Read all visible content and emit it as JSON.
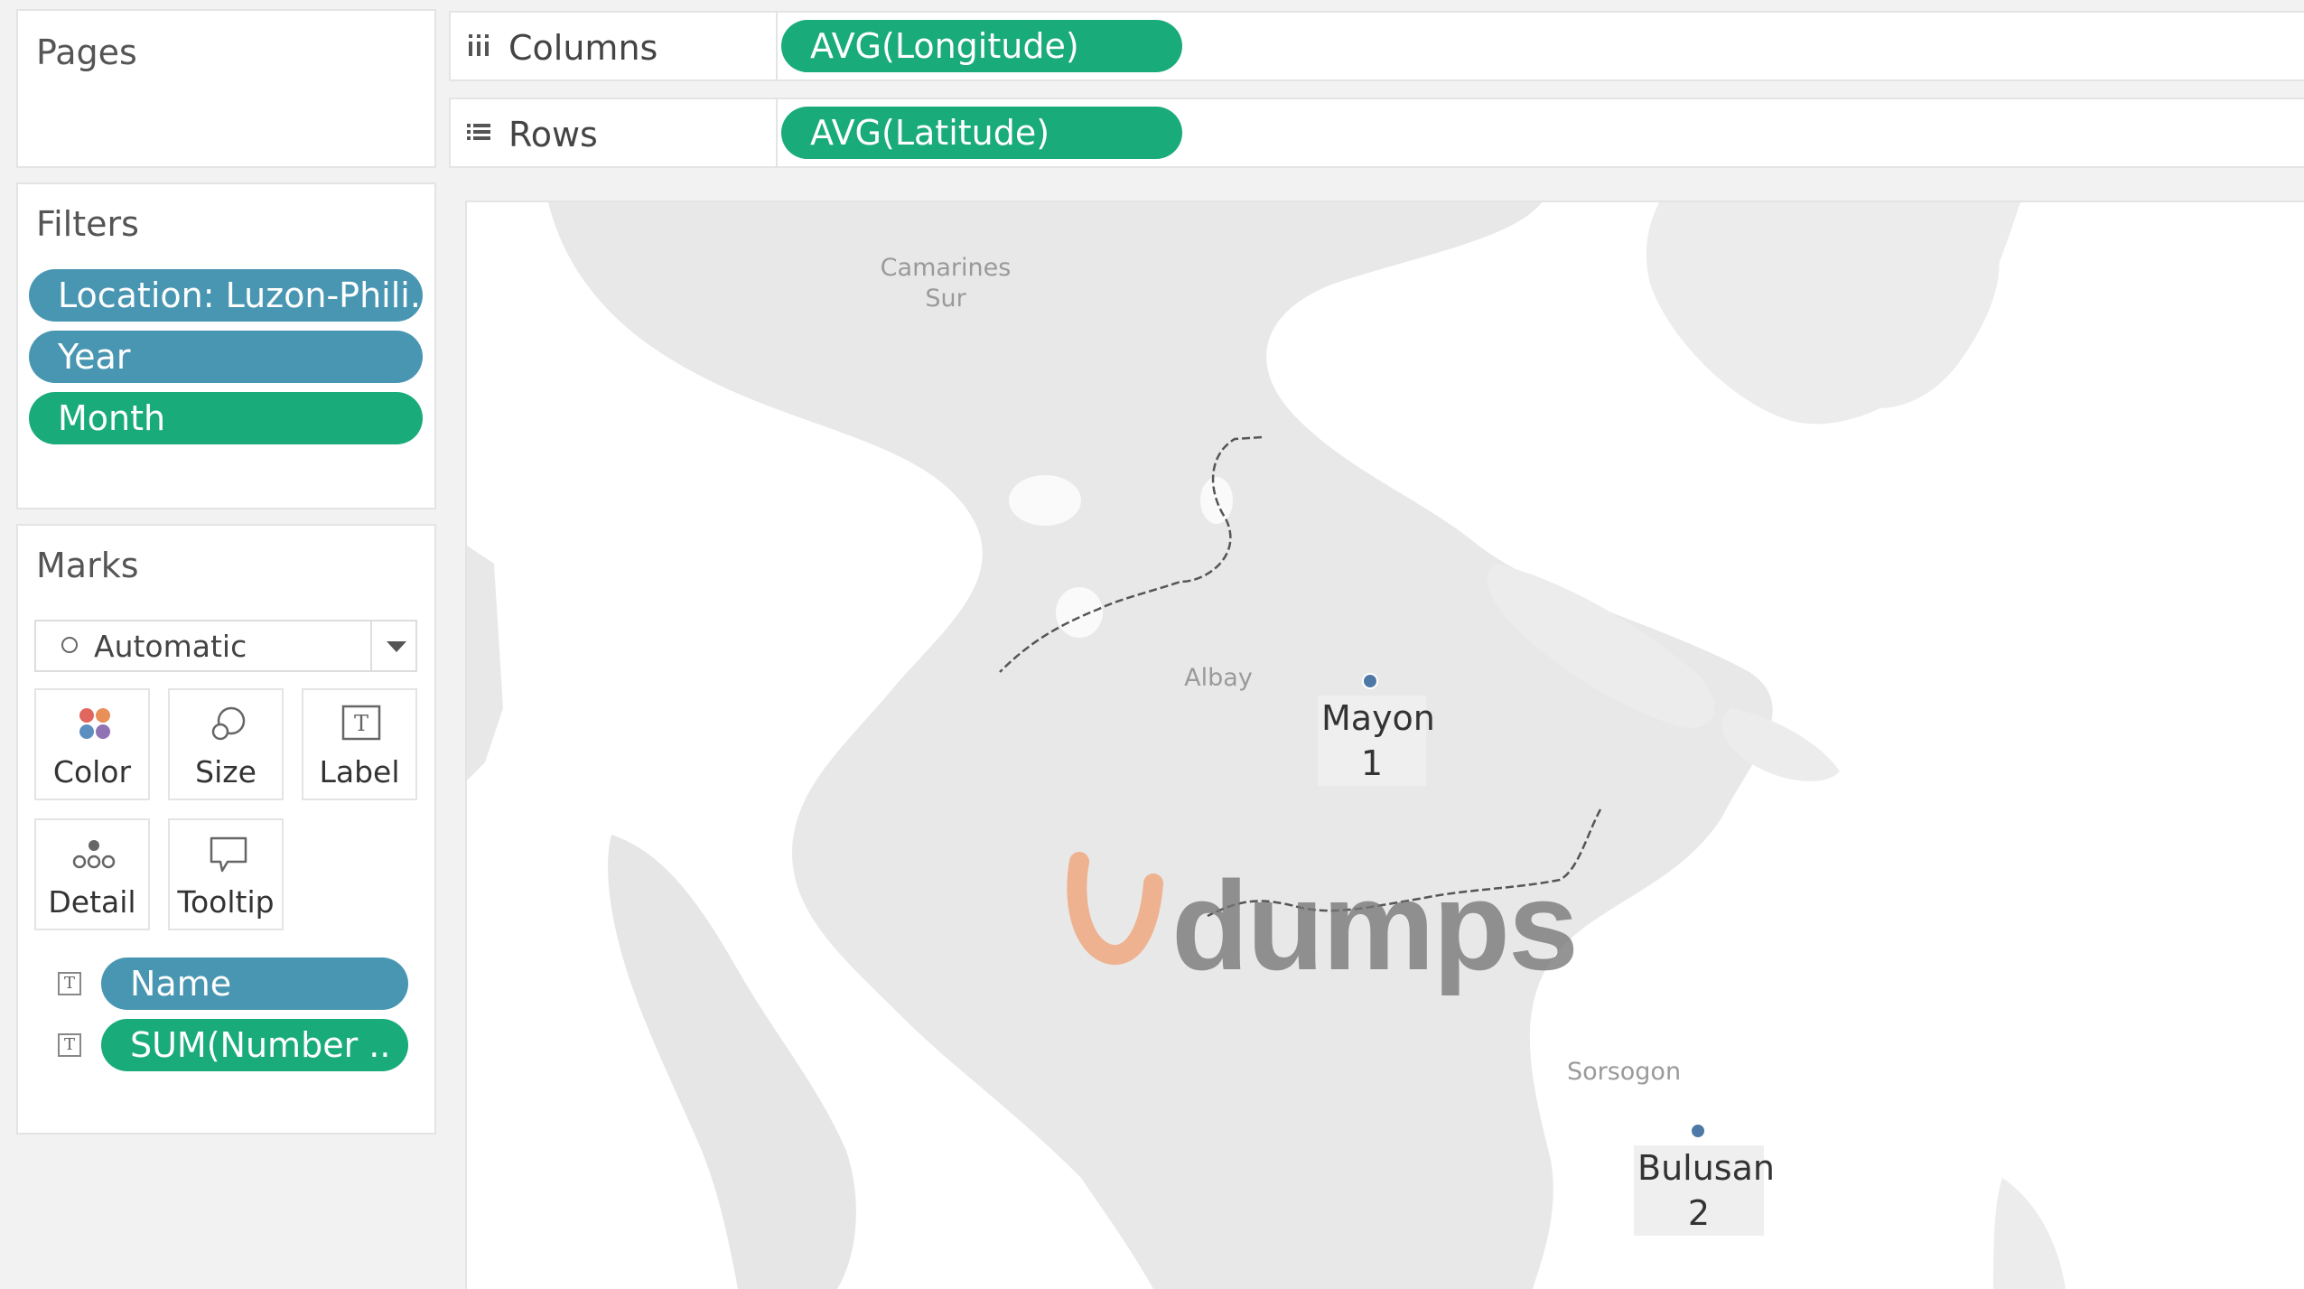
{
  "pages": {
    "title": "Pages"
  },
  "filters": {
    "title": "Filters",
    "items": [
      {
        "label": "Location: Luzon-Phili..",
        "color": "#4996b2"
      },
      {
        "label": "Year",
        "color": "#4996b2"
      },
      {
        "label": "Month",
        "color": "#1aab7b"
      }
    ]
  },
  "marks": {
    "title": "Marks",
    "mark_type": "Automatic",
    "tiles": {
      "color": "Color",
      "size": "Size",
      "label": "Label",
      "detail": "Detail",
      "tooltip": "Tooltip"
    },
    "fields": [
      {
        "label": "Name",
        "kind": "label",
        "color": "#4996b2"
      },
      {
        "label": "SUM(Number ..",
        "kind": "label",
        "color": "#1aab7b"
      }
    ]
  },
  "shelves": {
    "columns": {
      "label": "Columns",
      "pill": "AVG(Longitude)"
    },
    "rows": {
      "label": "Rows",
      "pill": "AVG(Latitude)"
    }
  },
  "map": {
    "places": [
      "Camarines Sur",
      "Albay",
      "Sorsogon"
    ],
    "points": [
      {
        "name": "Mayon",
        "value": "1"
      },
      {
        "name": "Bulusan",
        "value": "2"
      }
    ],
    "point_color": "#4e79a7"
  },
  "watermark": {
    "text": "dumps"
  }
}
